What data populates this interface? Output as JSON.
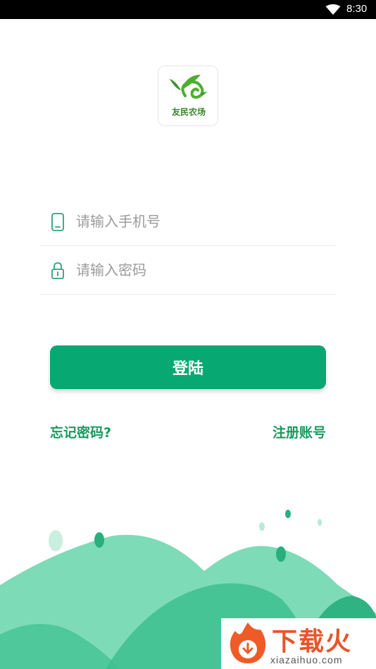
{
  "status_bar": {
    "time": "8:30",
    "wifi_icon": "wifi-icon"
  },
  "logo": {
    "text": "友民农场",
    "icon": "leaf-logo-icon"
  },
  "form": {
    "phone_placeholder": "请输入手机号",
    "password_placeholder": "请输入密码",
    "phone_icon": "phone-icon",
    "password_icon": "lock-icon"
  },
  "login_button": "登陆",
  "links": {
    "forgot_password": "忘记密码?",
    "register": "注册账号"
  },
  "watermark": {
    "brand": "下载火",
    "url": "xiazaihuo.com"
  },
  "colors": {
    "primary": "#07a872",
    "link": "#1a9a5e",
    "hill_light": "#7edbb8",
    "hill_dark": "#3cc08f"
  }
}
